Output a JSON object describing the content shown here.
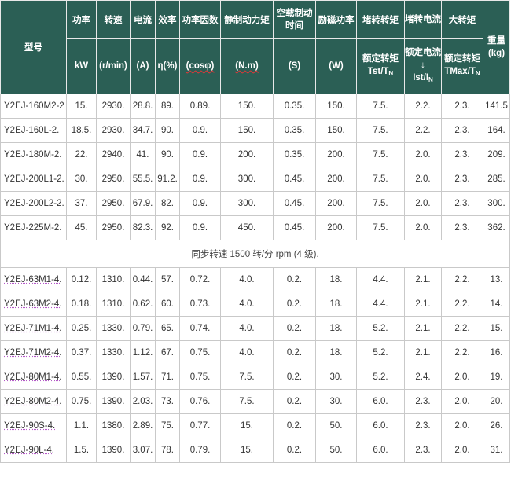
{
  "rows_top": [
    [
      "Y2EJ-160M2-2",
      "15.",
      "2930.",
      "28.8.",
      "89.",
      "0.89.",
      "150.",
      "0.35.",
      "150.",
      "7.5.",
      "2.2.",
      "2.3.",
      "141.5"
    ],
    [
      "Y2EJ-160L-2.",
      "18.5.",
      "2930.",
      "34.7.",
      "90.",
      "0.9.",
      "150.",
      "0.35.",
      "150.",
      "7.5.",
      "2.2.",
      "2.3.",
      "164."
    ],
    [
      "Y2EJ-180M-2.",
      "22.",
      "2940.",
      "41.",
      "90.",
      "0.9.",
      "200.",
      "0.35.",
      "200.",
      "7.5.",
      "2.0.",
      "2.3.",
      "209."
    ],
    [
      "Y2EJ-200L1-2.",
      "30.",
      "2950.",
      "55.5.",
      "91.2.",
      "0.9.",
      "300.",
      "0.45.",
      "200.",
      "7.5.",
      "2.0.",
      "2.3.",
      "285."
    ],
    [
      "Y2EJ-200L2-2.",
      "37.",
      "2950.",
      "67.9.",
      "82.",
      "0.9.",
      "300.",
      "0.45.",
      "200.",
      "7.5.",
      "2.0.",
      "2.3.",
      "300."
    ],
    [
      "Y2EJ-225M-2.",
      "45.",
      "2950.",
      "82.3.",
      "92.",
      "0.9.",
      "450.",
      "0.45.",
      "200.",
      "7.5.",
      "2.0.",
      "2.3.",
      "362."
    ]
  ],
  "header": {
    "model": "型号",
    "power": "功率",
    "speed": "转速",
    "current": "电流",
    "efficiency": "效率",
    "power_factor": "功率因数",
    "static_torque": "静制动力矩",
    "noload_brake_time": "空载制动时间",
    "excitation_power": "励磁功率",
    "locked_torque": "堵转转矩",
    "locked_current": "堵转电流",
    "max_torque": "大转矩",
    "weight_label": "重量",
    "weight_unit": "(kg)",
    "power_unit": "kW",
    "speed_unit": "(r/min)",
    "current_unit": "(A)",
    "efficiency_unit": "η(%)",
    "power_factor_unit": "(cosφ)",
    "static_torque_unit": "(N.m)",
    "noload_brake_time_unit": "(S)",
    "excitation_power_unit": "(W)",
    "locked_torque_sub_label": "额定转矩",
    "locked_torque_ratio_main": "Tst/T",
    "locked_torque_ratio_sub": "N",
    "locked_current_sub_label": "额定电流↓",
    "locked_current_ratio_main": "Ist/I",
    "locked_current_ratio_sub": "N",
    "max_torque_sub_label": "额定转矩",
    "max_torque_ratio_main": "TMax/T",
    "max_torque_ratio_sub": "N"
  },
  "section_title": "同步转速 1500 转/分 rpm (4 级).",
  "rows_bottom": [
    [
      "Y2EJ-63M1-4.",
      "0.12.",
      "1310.",
      "0.44.",
      "57.",
      "0.72.",
      "4.0.",
      "0.2.",
      "18.",
      "4.4.",
      "2.1.",
      "2.2.",
      "13."
    ],
    [
      "Y2EJ-63M2-4.",
      "0.18.",
      "1310.",
      "0.62.",
      "60.",
      "0.73.",
      "4.0.",
      "0.2.",
      "18.",
      "4.4.",
      "2.1.",
      "2.2.",
      "14."
    ],
    [
      "Y2EJ-71M1-4.",
      "0.25.",
      "1330.",
      "0.79.",
      "65.",
      "0.74.",
      "4.0.",
      "0.2.",
      "18.",
      "5.2.",
      "2.1.",
      "2.2.",
      "15."
    ],
    [
      "Y2EJ-71M2-4.",
      "0.37.",
      "1330.",
      "1.12.",
      "67.",
      "0.75.",
      "4.0.",
      "0.2.",
      "18.",
      "5.2.",
      "2.1.",
      "2.2.",
      "16."
    ],
    [
      "Y2EJ-80M1-4.",
      "0.55.",
      "1390.",
      "1.57.",
      "71.",
      "0.75.",
      "7.5.",
      "0.2.",
      "30.",
      "5.2.",
      "2.4.",
      "2.0.",
      "19."
    ],
    [
      "Y2EJ-80M2-4.",
      "0.75.",
      "1390.",
      "2.03.",
      "73.",
      "0.76.",
      "7.5.",
      "0.2.",
      "30.",
      "6.0.",
      "2.3.",
      "2.0.",
      "20."
    ],
    [
      "Y2EJ-90S-4.",
      "1.1.",
      "1380.",
      "2.89.",
      "75.",
      "0.77.",
      "15.",
      "0.2.",
      "50.",
      "6.0.",
      "2.3.",
      "2.0.",
      "26."
    ],
    [
      "Y2EJ-90L-4.",
      "1.5.",
      "1390.",
      "3.07.",
      "78.",
      "0.79.",
      "15.",
      "0.2.",
      "50.",
      "6.0.",
      "2.3.",
      "2.0.",
      "31."
    ]
  ]
}
